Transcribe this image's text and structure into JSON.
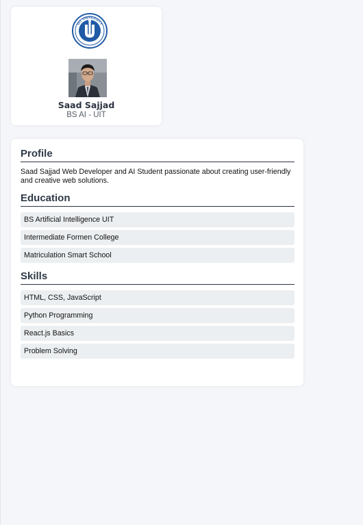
{
  "header": {
    "name": "Saad Sajjad",
    "subtitle": "BS AI - UIT",
    "logo_text": "UIT UNIVERSITY"
  },
  "profile": {
    "title": "Profile",
    "text": "Saad Sajjad Web Developer and AI Student passionate about creating user-friendly and creative web solutions."
  },
  "education": {
    "title": "Education",
    "items": [
      "BS Artificial Intelligence UIT",
      "Intermediate Formen College",
      "Matriculation Smart School"
    ]
  },
  "skills": {
    "title": "Skills",
    "items": [
      "HTML, CSS, JavaScript",
      "Python Programming",
      "React.js Basics",
      "Problem Solving"
    ]
  },
  "colors": {
    "logo_blue": "#1f5aa6",
    "list_bg": "#eceff1"
  }
}
